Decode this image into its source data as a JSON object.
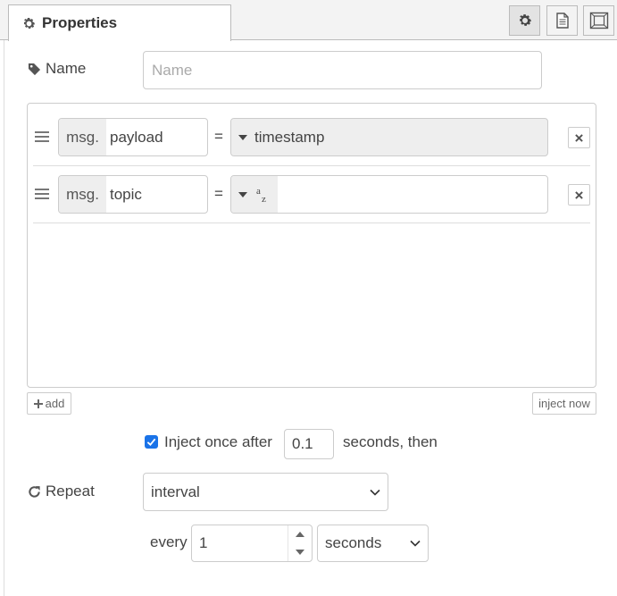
{
  "tab": {
    "title": "Properties"
  },
  "header_buttons": [
    {
      "name": "settings-tab-button",
      "icon": "gear-icon"
    },
    {
      "name": "description-tab-button",
      "icon": "document-icon"
    },
    {
      "name": "appearance-tab-button",
      "icon": "frame-icon"
    }
  ],
  "name_field": {
    "label": "Name",
    "placeholder": "Name",
    "value": ""
  },
  "properties": [
    {
      "prefix": "msg.",
      "property": "payload",
      "operator": "=",
      "type_label": "timestamp",
      "value": ""
    },
    {
      "prefix": "msg.",
      "property": "topic",
      "operator": "=",
      "type_label": "az",
      "value": ""
    }
  ],
  "add_button": {
    "label": "add"
  },
  "inject_now_button": {
    "label": "inject now"
  },
  "inject_once": {
    "checked": true,
    "label": "Inject once after",
    "delay": "0.1",
    "suffix": "seconds, then"
  },
  "repeat": {
    "label": "Repeat",
    "mode": "interval",
    "every_label": "every",
    "every_value": "1",
    "unit": "seconds"
  },
  "colors": {
    "checkbox": "#1a73e8",
    "header_bg": "#f3f3f3",
    "border": "#cccccc"
  }
}
